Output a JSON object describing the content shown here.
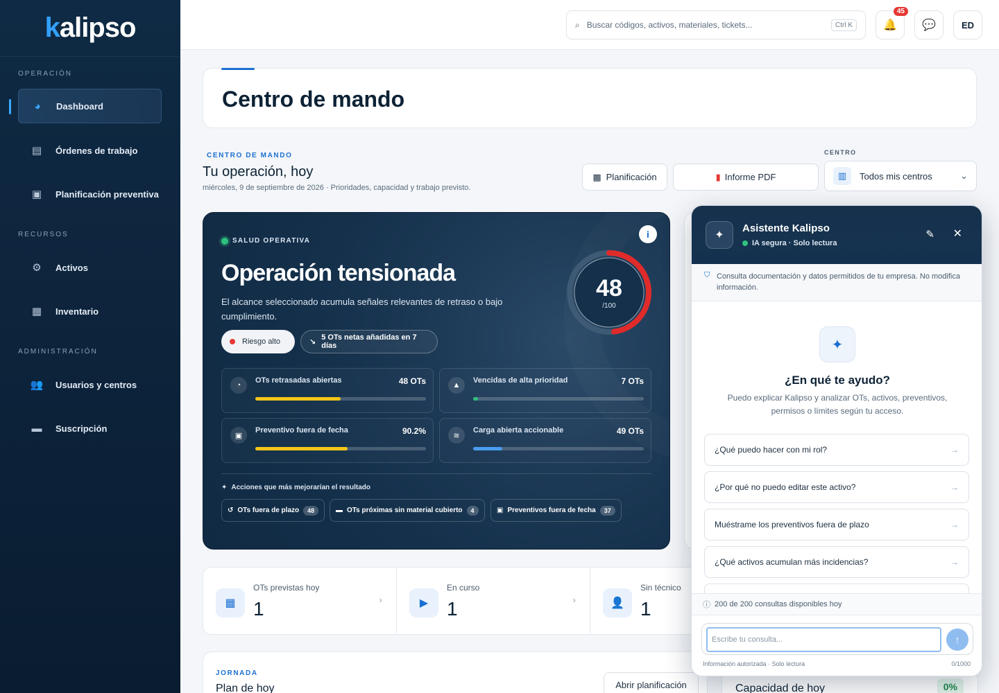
{
  "brand": {
    "logo_k": "k",
    "logo_rest": "alipso"
  },
  "sidebar": {
    "sections": [
      {
        "label": "OPERACIÓN"
      },
      {
        "label": "RECURSOS"
      },
      {
        "label": "ADMINISTRACIÓN"
      }
    ],
    "items": [
      {
        "label": "Dashboard",
        "icon": "dashboard-gauge-icon"
      },
      {
        "label": "Órdenes de trabajo",
        "icon": "clipboard-icon"
      },
      {
        "label": "Planificación preventiva",
        "icon": "calendar-check-icon"
      },
      {
        "label": "Activos",
        "icon": "gears-icon"
      },
      {
        "label": "Inventario",
        "icon": "boxes-icon"
      },
      {
        "label": "Usuarios y centros",
        "icon": "users-icon"
      },
      {
        "label": "Suscripción",
        "icon": "credit-card-icon"
      }
    ]
  },
  "topbar": {
    "search_placeholder": "Buscar códigos, activos, materiales, tickets...",
    "search_shortcut": "Ctrl K",
    "notifications_count": "45",
    "avatar_initials": "ED"
  },
  "page": {
    "title": "Centro de mando"
  },
  "overview": {
    "eyebrow": "CENTRO DE MANDO",
    "heading": "Tu operación, hoy",
    "subtitle": "miércoles, 9 de septiembre de 2026 · Prioridades, capacidad y trabajo previsto.",
    "planning_button": "Planificación",
    "pdf_button": "Informe PDF",
    "center_label": "CENTRO",
    "center_value": "Todos mis centros"
  },
  "health": {
    "eyebrow": "SALUD OPERATIVA",
    "title": "Operación tensionada",
    "description": "El alcance seleccionado acumula señales relevantes de retraso o bajo cumplimiento.",
    "risk_pill": "Riesgo alto",
    "trend_pill": "5 OTs netas añadidas en 7 días",
    "score": 48,
    "score_display": "48",
    "score_max": "/100",
    "metrics": [
      {
        "label": "OTs retrasadas abiertas",
        "value": "48 OTs",
        "progress": 0.5,
        "color": "#f5c518",
        "icon": "speedometer-icon"
      },
      {
        "label": "Vencidas de alta prioridad",
        "value": "7 OTs",
        "progress": 0.03,
        "color": "#2ec27e",
        "icon": "warning-icon"
      },
      {
        "label": "Preventivo fuera de fecha",
        "value": "90.2%",
        "progress": 0.54,
        "color": "#f5c518",
        "icon": "calendar-icon"
      },
      {
        "label": "Carga abierta accionable",
        "value": "49 OTs",
        "progress": 0.17,
        "color": "#4a9cf0",
        "icon": "layers-icon"
      }
    ],
    "actions_title": "Acciones que más mejorarían el resultado",
    "actions": [
      {
        "label": "OTs fuera de plazo",
        "count": "48"
      },
      {
        "label": "OTs próximas sin material cubierto",
        "count": "4"
      },
      {
        "label": "Preventivos fuera de fecha",
        "count": "37"
      }
    ]
  },
  "stats": [
    {
      "label": "OTs previstas hoy",
      "value": "1"
    },
    {
      "label": "En curso",
      "value": "1"
    },
    {
      "label": "Sin técnico",
      "value": "1"
    }
  ],
  "jornada": {
    "eyebrow": "JORNADA",
    "title": "Plan de hoy",
    "button": "Abrir planificación"
  },
  "capacity": {
    "title": "Capacidad de hoy",
    "value": "0%"
  },
  "assistant": {
    "title": "Asistente Kalipso",
    "status": "IA segura · Solo lectura",
    "notice": "Consulta documentación y datos permitidos de tu empresa. No modifica información.",
    "help_title": "¿En qué te ayudo?",
    "help_text": "Puedo explicar Kalipso y analizar OTs, activos, preventivos, permisos o límites según tu acceso.",
    "suggestions": [
      "¿Qué puedo hacer con mi rol?",
      "¿Por qué no puedo editar este activo?",
      "Muéstrame los preventivos fuera de plazo",
      "¿Qué activos acumulan más incidencias?"
    ],
    "quota": "200 de 200 consultas disponibles hoy",
    "input_placeholder": "Escribe tu consulta...",
    "footer_left": "Información autorizada · Solo lectura",
    "footer_right": "0/1000"
  }
}
